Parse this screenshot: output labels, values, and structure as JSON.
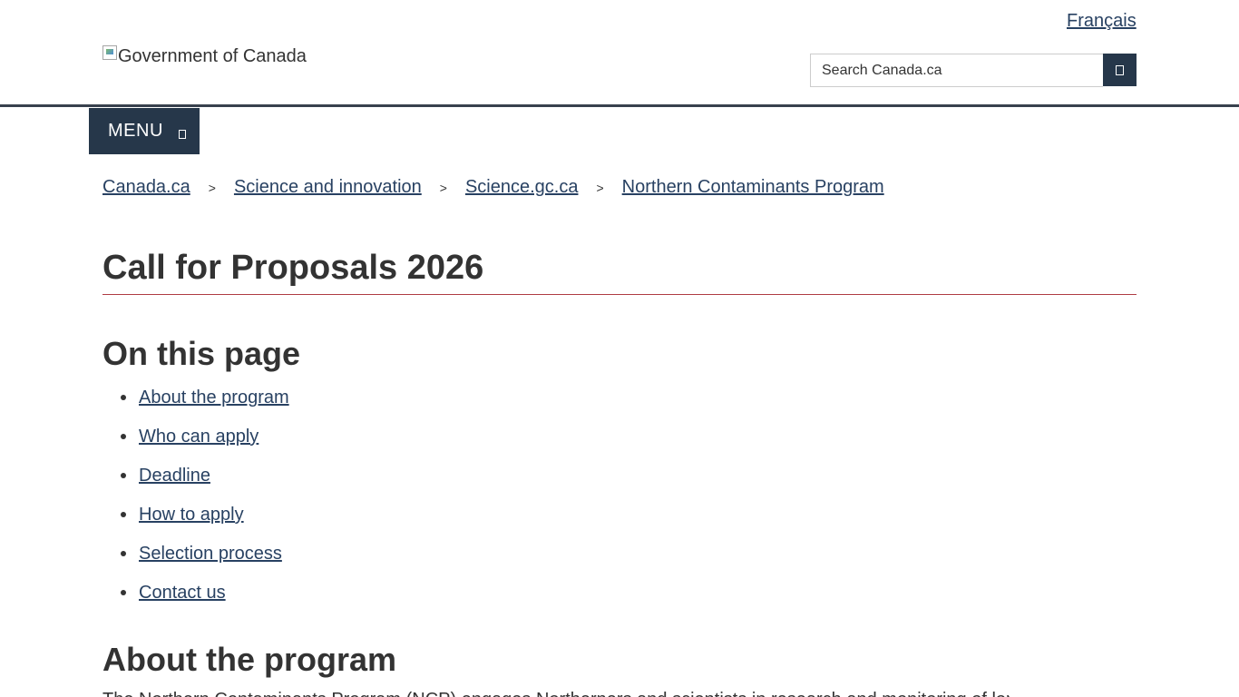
{
  "header": {
    "language_link": "Français",
    "logo_alt": "Government of Canada",
    "search": {
      "placeholder": "Search Canada.ca",
      "value": ""
    },
    "search_button_icon": "search-icon",
    "menu_label": "MENU",
    "menu_icon": "chevron-down-icon"
  },
  "breadcrumb": [
    {
      "label": "Canada.ca"
    },
    {
      "label": "Science and innovation"
    },
    {
      "label": "Science.gc.ca"
    },
    {
      "label": "Northern Contaminants Program"
    }
  ],
  "breadcrumb_separator": ">",
  "main": {
    "title": "Call for Proposals 2026",
    "toc_heading": "On this page",
    "toc_items": [
      {
        "label": "About the program"
      },
      {
        "label": "Who can apply"
      },
      {
        "label": "Deadline"
      },
      {
        "label": "How to apply"
      },
      {
        "label": "Selection process"
      },
      {
        "label": "Contact us"
      }
    ],
    "section_heading": "About the program",
    "section_intro": "The Northern Contaminants Program (NCP) engages Northerners and scientists in research and monitoring of long"
  },
  "colors": {
    "link": "#284162",
    "dark_blue": "#26374a",
    "title_rule": "#af3c43",
    "text": "#333333"
  }
}
